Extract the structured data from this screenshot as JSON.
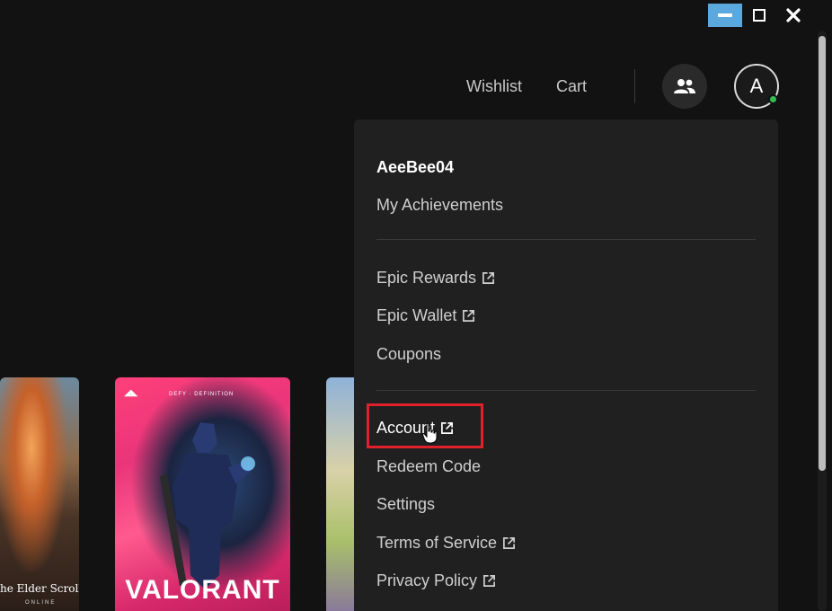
{
  "nav": {
    "wishlist": "Wishlist",
    "cart": "Cart",
    "avatar_initial": "A"
  },
  "menu": {
    "username": "AeeBee04",
    "achievements": "My Achievements",
    "items": [
      {
        "label": "Epic Rewards",
        "external": true
      },
      {
        "label": "Epic Wallet",
        "external": true
      },
      {
        "label": "Coupons",
        "external": false
      },
      {
        "label": "Account",
        "external": true
      },
      {
        "label": "Redeem Code",
        "external": false
      },
      {
        "label": "Settings",
        "external": false
      },
      {
        "label": "Terms of Service",
        "external": true
      },
      {
        "label": "Privacy Policy",
        "external": true
      }
    ]
  },
  "cards": {
    "eso_title": "he Elder Scrolls",
    "eso_sub": "ONLINE",
    "valorant_title": "VALORANT",
    "valorant_tag": "DEFY · DEFINITION"
  },
  "colors": {
    "accent_minimize": "#5aa8dd",
    "highlight": "#e0202a",
    "online": "#2fbf4f"
  }
}
